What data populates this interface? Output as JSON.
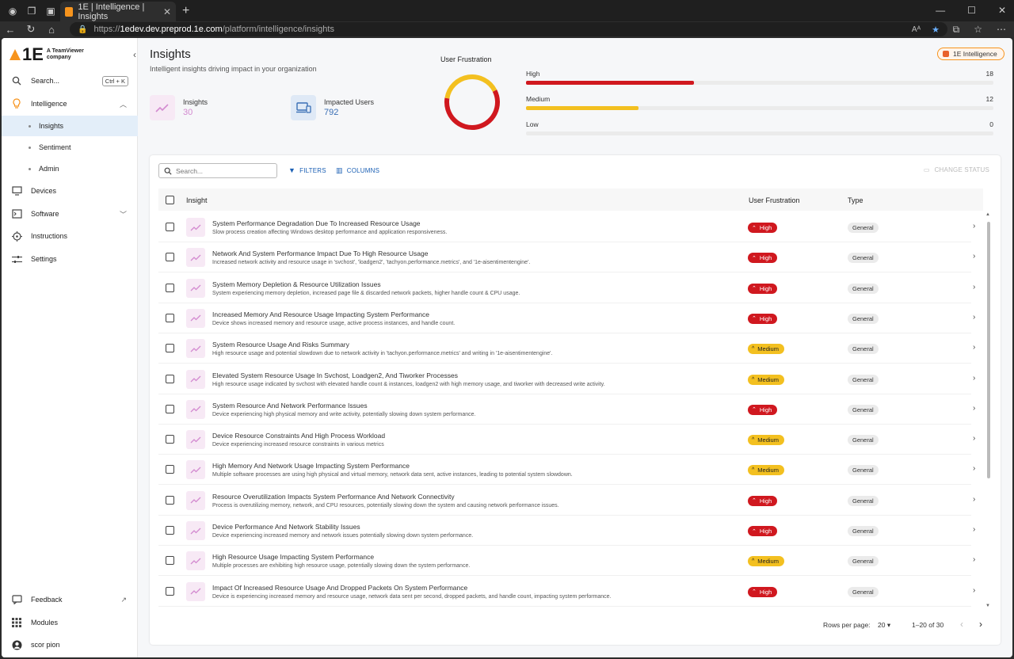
{
  "browser": {
    "tab_title": "1E | Intelligence | Insights",
    "url_prefix": "https://",
    "url_host": "1edev.dev.preprod.1e.com",
    "url_path": "/platform/intelligence/insights"
  },
  "sidebar": {
    "logo_text": "1E",
    "logo_sub1": "A TeamViewer",
    "logo_sub2": "company",
    "search_label": "Search...",
    "search_shortcut": "Ctrl + K",
    "items": [
      {
        "label": "Intelligence",
        "icon": "lightbulb-icon"
      },
      {
        "label": "Devices",
        "icon": "monitor-icon"
      },
      {
        "label": "Software",
        "icon": "terminal-icon"
      },
      {
        "label": "Instructions",
        "icon": "crosshair-icon"
      },
      {
        "label": "Settings",
        "icon": "sliders-icon"
      }
    ],
    "sub_items": [
      "Insights",
      "Sentiment",
      "Admin"
    ],
    "bottom": [
      {
        "label": "Feedback",
        "icon": "feedback-icon"
      },
      {
        "label": "Modules",
        "icon": "grid-icon"
      },
      {
        "label": "scor pion",
        "icon": "avatar-icon"
      }
    ]
  },
  "header": {
    "title": "Insights",
    "subtitle": "Intelligent insights driving impact in your organization",
    "badge": "1E Intelligence"
  },
  "kpis": {
    "insights_label": "Insights",
    "insights_value": "30",
    "users_label": "Impacted Users",
    "users_value": "792"
  },
  "frustration": {
    "title": "User Frustration",
    "levels": [
      {
        "label": "High",
        "value": 18,
        "color": "#d0181f"
      },
      {
        "label": "Medium",
        "value": 12,
        "color": "#f3c020"
      },
      {
        "label": "Low",
        "value": 0,
        "color": "#8bc34a"
      }
    ],
    "max": 30
  },
  "toolbar": {
    "search_placeholder": "Search...",
    "filters": "FILTERS",
    "columns": "COLUMNS",
    "change_status": "CHANGE STATUS"
  },
  "table": {
    "headers": {
      "insight": "Insight",
      "frustration": "User Frustration",
      "type": "Type"
    },
    "rows": [
      {
        "title": "System Performance Degradation Due To Increased Resource Usage",
        "desc": "Slow process creation affecting Windows desktop performance and application responsiveness.",
        "severity": "High",
        "type": "General"
      },
      {
        "title": "Network And System Performance Impact Due To High Resource Usage",
        "desc": "Increased network activity and resource usage in 'svchost', 'loadgen2', 'tachyon.performance.metrics', and '1e-aisentimentengine'.",
        "severity": "High",
        "type": "General"
      },
      {
        "title": "System Memory Depletion & Resource Utilization Issues",
        "desc": "System experiencing memory depletion, increased page file & discarded network packets, higher handle count & CPU usage.",
        "severity": "High",
        "type": "General"
      },
      {
        "title": "Increased Memory And Resource Usage Impacting System Performance",
        "desc": "Device shows increased memory and resource usage, active process instances, and handle count.",
        "severity": "High",
        "type": "General"
      },
      {
        "title": "System Resource Usage And Risks Summary",
        "desc": "High resource usage and potential slowdown due to network activity in 'tachyon.performance.metrics' and writing in '1e-aisentimentengine'.",
        "severity": "Medium",
        "type": "General"
      },
      {
        "title": "Elevated System Resource Usage In Svchost, Loadgen2, And Tiworker Processes",
        "desc": "High resource usage indicated by svchost with elevated handle count & instances, loadgen2 with high memory usage, and tiworker with decreased write activity.",
        "severity": "Medium",
        "type": "General"
      },
      {
        "title": "System Resource And Network Performance Issues",
        "desc": "Device experiencing high physical memory and write activity, potentially slowing down system performance.",
        "severity": "High",
        "type": "General"
      },
      {
        "title": "Device Resource Constraints And High Process Workload",
        "desc": "Device experiencing increased resource constraints in various metrics",
        "severity": "Medium",
        "type": "General"
      },
      {
        "title": "High Memory And Network Usage Impacting System Performance",
        "desc": "Multiple software processes are using high physical and virtual memory, network data sent, active instances, leading to potential system slowdown.",
        "severity": "Medium",
        "type": "General"
      },
      {
        "title": "Resource Overutilization Impacts System Performance And Network Connectivity",
        "desc": "Process is overutilizing memory, network, and CPU resources, potentially slowing down the system and causing network performance issues.",
        "severity": "High",
        "type": "General"
      },
      {
        "title": "Device Performance And Network Stability Issues",
        "desc": "Device experiencing increased memory and network issues potentially slowing down system performance.",
        "severity": "High",
        "type": "General"
      },
      {
        "title": "High Resource Usage Impacting System Performance",
        "desc": "Multiple processes are exhibiting high resource usage, potentially slowing down the system performance.",
        "severity": "Medium",
        "type": "General"
      },
      {
        "title": "Impact Of Increased Resource Usage And Dropped Packets On System Performance",
        "desc": "Device is experiencing increased memory and resource usage, network data sent per second, dropped packets, and handle count, impacting system performance.",
        "severity": "High",
        "type": "General"
      }
    ]
  },
  "pagination": {
    "rows_per_page_label": "Rows per page:",
    "rows_per_page": "20",
    "range": "1–20 of 30"
  }
}
